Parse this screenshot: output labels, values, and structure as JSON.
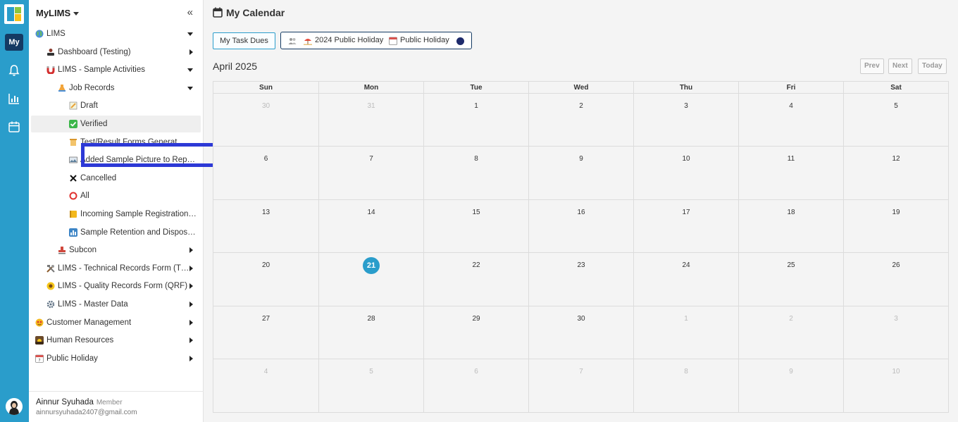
{
  "rail": {
    "my_label": "My"
  },
  "sidebar": {
    "title": "MyLIMS",
    "collapse_icon": "«",
    "items": [
      {
        "label": "LIMS",
        "icon": "globe-icon"
      },
      {
        "label": "Dashboard (Testing)",
        "icon": "user-icon"
      },
      {
        "label": "LIMS - Sample Activities",
        "icon": "magnet-icon"
      },
      {
        "label": "Job Records",
        "icon": "flask-icon"
      },
      {
        "label": "Draft",
        "icon": "memo-icon"
      },
      {
        "label": "Verified",
        "icon": "check-icon"
      },
      {
        "label": "Test/Result Forms Generated",
        "icon": "scroll-icon"
      },
      {
        "label": "Added Sample Picture to Repor…",
        "icon": "picture-icon"
      },
      {
        "label": "Cancelled",
        "icon": "x-icon"
      },
      {
        "label": "All",
        "icon": "circle-icon"
      },
      {
        "label": "Incoming Sample Registration …",
        "icon": "ledger-icon"
      },
      {
        "label": "Sample Retention and Disposal…",
        "icon": "chart-icon"
      },
      {
        "label": "Subcon",
        "icon": "stamp-icon"
      },
      {
        "label": "LIMS - Technical Records Form (T…",
        "icon": "tools-icon"
      },
      {
        "label": "LIMS - Quality Records Form (QRF)",
        "icon": "flower-icon"
      },
      {
        "label": "LIMS - Master Data",
        "icon": "gear-icon"
      },
      {
        "label": "Customer Management",
        "icon": "star-face-icon"
      },
      {
        "label": "Human Resources",
        "icon": "sunrise-icon"
      },
      {
        "label": "Public Holiday",
        "icon": "calendar-icon"
      }
    ],
    "user": {
      "name": "Ainnur Syuhada",
      "role": "Member",
      "email": "ainnursyuhada2407@gmail.com"
    }
  },
  "main": {
    "title": "My Calendar",
    "task_button": "My Task Dues",
    "filters": {
      "holiday_2024": "2024 Public Holiday",
      "public_holiday": "Public Holiday"
    },
    "month_label": "April 2025",
    "nav": {
      "prev": "Prev",
      "next": "Next",
      "today": "Today"
    },
    "weekdays": [
      "Sun",
      "Mon",
      "Tue",
      "Wed",
      "Thu",
      "Fri",
      "Sat"
    ],
    "weeks": [
      [
        "30",
        "31",
        "1",
        "2",
        "3",
        "4",
        "5"
      ],
      [
        "6",
        "7",
        "8",
        "9",
        "10",
        "11",
        "12"
      ],
      [
        "13",
        "14",
        "15",
        "16",
        "17",
        "18",
        "19"
      ],
      [
        "20",
        "21",
        "22",
        "23",
        "24",
        "25",
        "26"
      ],
      [
        "27",
        "28",
        "29",
        "30",
        "1",
        "2",
        "3"
      ],
      [
        "4",
        "5",
        "6",
        "7",
        "8",
        "9",
        "10"
      ]
    ],
    "today": "21",
    "colors": {
      "accent": "#2a9dcb",
      "navy": "#143a63",
      "highlight": "#2d39d6"
    }
  }
}
